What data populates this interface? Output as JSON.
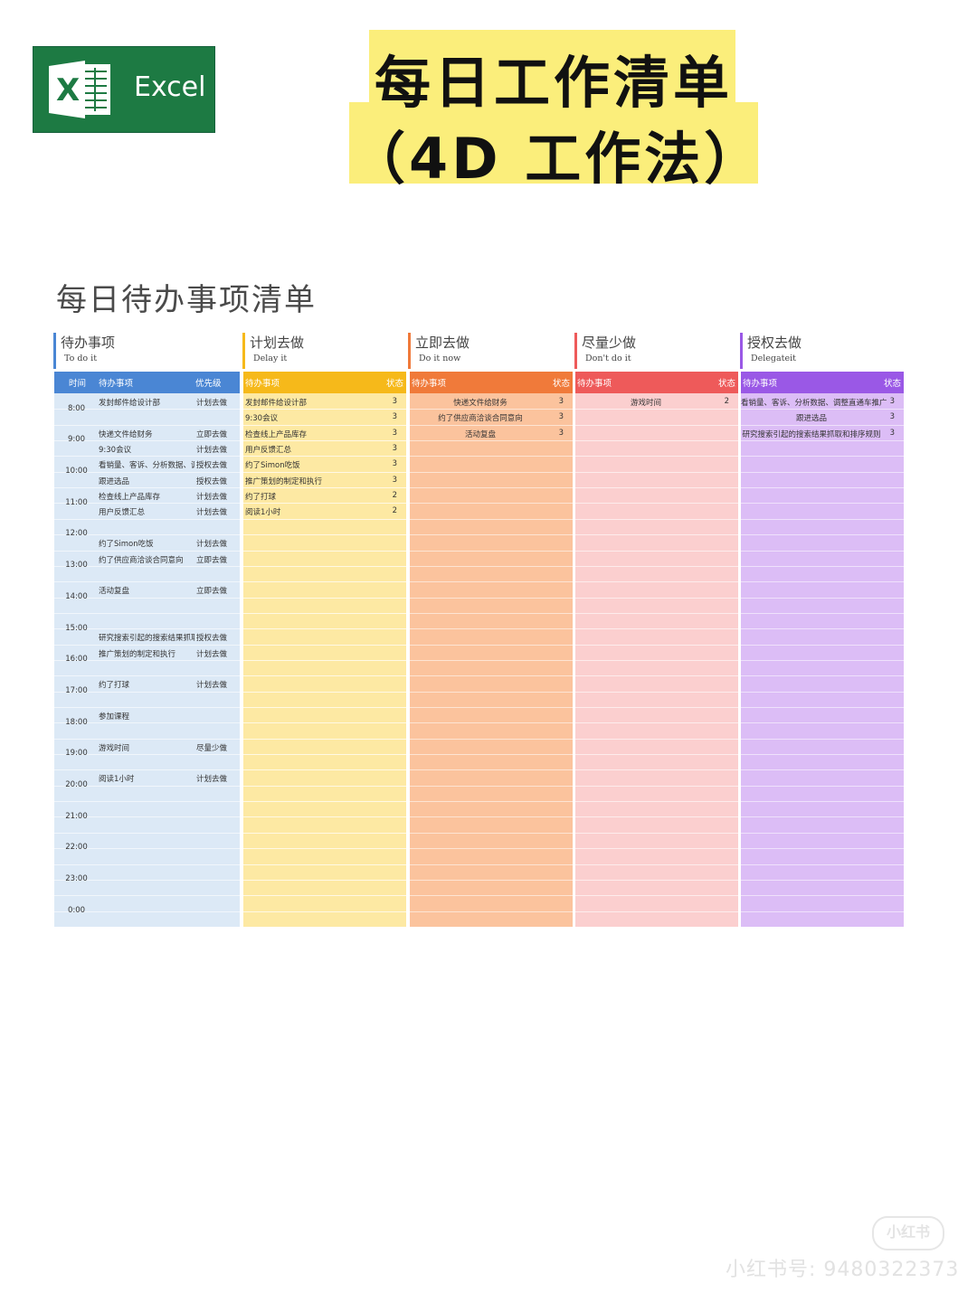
{
  "logo": {
    "text": "Excel",
    "letter": "X"
  },
  "title": {
    "line1": "每日工作清单",
    "line2": "（4D 工作法）"
  },
  "section_title": "每日待办事项清单",
  "columns": [
    {
      "cn": "待办事项",
      "en": "To do it",
      "color": "#4a86d4"
    },
    {
      "cn": "计划去做",
      "en": "Delay it",
      "color": "#f6b91a"
    },
    {
      "cn": "立即去做",
      "en": "Do it now",
      "color": "#f07a3a"
    },
    {
      "cn": "尽量少做",
      "en": "Don't do it",
      "color": "#ee5a5a"
    },
    {
      "cn": "授权去做",
      "en": "Delegateit",
      "color": "#9a58e6"
    }
  ],
  "todo_panel": {
    "headers": {
      "time": "时间",
      "item": "待办事项",
      "priority": "优先级"
    },
    "times": [
      "8:00",
      "9:00",
      "10:00",
      "11:00",
      "12:00",
      "13:00",
      "14:00",
      "15:00",
      "16:00",
      "17:00",
      "18:00",
      "19:00",
      "20:00",
      "21:00",
      "22:00",
      "23:00",
      "0:00"
    ],
    "rows": [
      {
        "slot": 0,
        "item": "发封邮件给设计部",
        "priority": "计划去做"
      },
      {
        "slot": 2,
        "item": "快递文件给财务",
        "priority": "立即去做"
      },
      {
        "slot": 3,
        "item": "9:30会议",
        "priority": "计划去做"
      },
      {
        "slot": 4,
        "item": "看销量、客诉、分析数据、调",
        "priority": "授权去做"
      },
      {
        "slot": 5,
        "item": "跟进选品",
        "priority": "授权去做"
      },
      {
        "slot": 6,
        "item": "检查线上产品库存",
        "priority": "计划去做"
      },
      {
        "slot": 7,
        "item": "用户反馈汇总",
        "priority": "计划去做"
      },
      {
        "slot": 9,
        "item": "约了Simon吃饭",
        "priority": "计划去做"
      },
      {
        "slot": 10,
        "item": "约了供应商洽谈合同意向",
        "priority": "立即去做"
      },
      {
        "slot": 12,
        "item": "活动复盘",
        "priority": "立即去做"
      },
      {
        "slot": 15,
        "item": "研究搜索引起的搜索结果抓取",
        "priority": "授权去做"
      },
      {
        "slot": 16,
        "item": "推广策划的制定和执行",
        "priority": "计划去做"
      },
      {
        "slot": 18,
        "item": "约了打球",
        "priority": "计划去做"
      },
      {
        "slot": 20,
        "item": "参加课程",
        "priority": ""
      },
      {
        "slot": 22,
        "item": "游戏时间",
        "priority": "尽量少做"
      },
      {
        "slot": 24,
        "item": "阅读1小时",
        "priority": "计划去做"
      }
    ]
  },
  "delay_panel": {
    "headers": {
      "item": "待办事项",
      "status": "状态"
    },
    "rows": [
      {
        "item": "发封邮件给设计部",
        "status": "3"
      },
      {
        "item": "9:30会议",
        "status": "3"
      },
      {
        "item": "检查线上产品库存",
        "status": "3"
      },
      {
        "item": "用户反馈汇总",
        "status": "3"
      },
      {
        "item": "约了Simon吃饭",
        "status": "3"
      },
      {
        "item": "推广策划的制定和执行",
        "status": "3"
      },
      {
        "item": "约了打球",
        "status": "2"
      },
      {
        "item": "阅读1小时",
        "status": "2"
      }
    ]
  },
  "now_panel": {
    "headers": {
      "item": "待办事项",
      "status": "状态"
    },
    "rows": [
      {
        "item": "快递文件给财务",
        "status": "3"
      },
      {
        "item": "约了供应商洽谈合同意向",
        "status": "3"
      },
      {
        "item": "活动复盘",
        "status": "3"
      }
    ]
  },
  "dont_panel": {
    "headers": {
      "item": "待办事项",
      "status": "状态"
    },
    "rows": [
      {
        "item": "游戏时间",
        "status": "2"
      }
    ]
  },
  "delegate_panel": {
    "headers": {
      "item": "待办事项",
      "status": "状态"
    },
    "rows": [
      {
        "item": "看销量、客诉、分析数据、调整直通车推广",
        "status": "3"
      },
      {
        "item": "跟进选品",
        "status": "3"
      },
      {
        "item": "研究搜索引起的搜索结果抓取和排序规则",
        "status": "3"
      }
    ]
  },
  "watermark": {
    "badge": "小红书",
    "id": "小红书号: 9480322373"
  }
}
